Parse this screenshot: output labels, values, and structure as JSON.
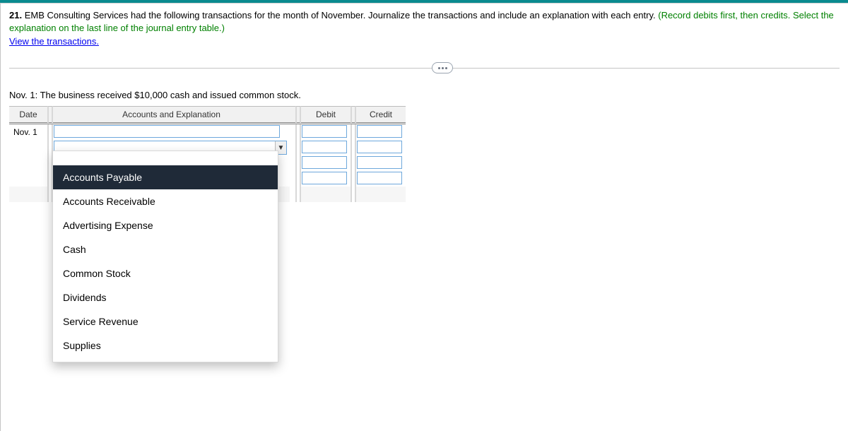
{
  "question": {
    "number": "21.",
    "body_black": " EMB Consulting Services had the following transactions for the month of November. Journalize the transactions and include an explanation with each entry. ",
    "body_green": "(Record debits first, then credits. Select the explanation on the last line of the journal entry table.)",
    "view_link": "View the transactions."
  },
  "transaction_label": "Nov. 1: The business received $10,000 cash and issued common stock.",
  "table": {
    "headers": {
      "date": "Date",
      "accounts": "Accounts and Explanation",
      "debit": "Debit",
      "credit": "Credit"
    },
    "date_value": "Nov. 1"
  },
  "dropdown": {
    "caret_glyph": "▼",
    "options": [
      "Accounts Payable",
      "Accounts Receivable",
      "Advertising Expense",
      "Cash",
      "Common Stock",
      "Dividends",
      "Service Revenue",
      "Supplies"
    ],
    "active_index": 0
  }
}
